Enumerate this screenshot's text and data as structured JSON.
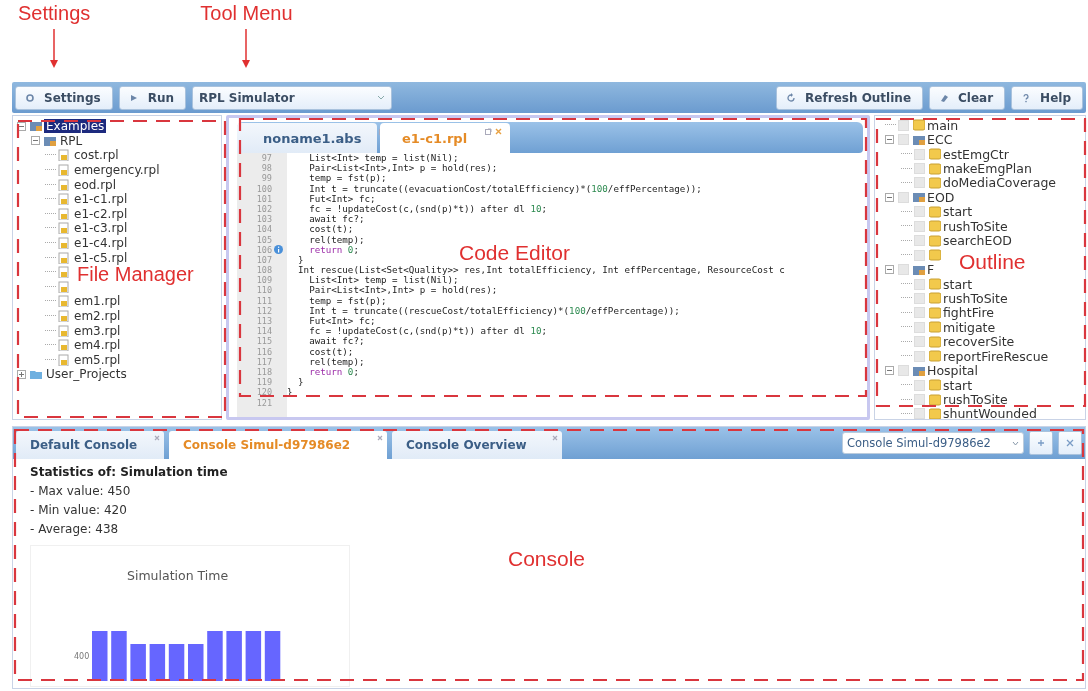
{
  "annotations": {
    "settings_callout": "Settings",
    "tool_menu_callout": "Tool Menu",
    "file_manager_label": "File Manager",
    "code_editor_label": "Code Editor",
    "outline_label": "Outline",
    "console_label": "Console"
  },
  "toolbar": {
    "left_buttons": [
      {
        "label": "Settings"
      },
      {
        "label": "Run"
      }
    ],
    "tool_select": "RPL Simulator",
    "right_buttons": [
      {
        "label": "Refresh Outline"
      },
      {
        "label": "Clear"
      },
      {
        "label": "Help"
      }
    ]
  },
  "file_tree": [
    {
      "label": "Examples",
      "kind": "package",
      "selected": true,
      "expanded": true,
      "children": [
        {
          "label": "RPL",
          "kind": "package",
          "selected": false,
          "expanded": true,
          "children": [
            {
              "label": "cost.rpl",
              "kind": "file",
              "selected": false
            },
            {
              "label": "emergency.rpl",
              "kind": "file",
              "selected": false
            },
            {
              "label": "eod.rpl",
              "kind": "file",
              "selected": false
            },
            {
              "label": "e1-c1.rpl",
              "kind": "file",
              "selected": false
            },
            {
              "label": "e1-c2.rpl",
              "kind": "file",
              "selected": false
            },
            {
              "label": "e1-c3.rpl",
              "kind": "file",
              "selected": false
            },
            {
              "label": "e1-c4.rpl",
              "kind": "file",
              "selected": false
            },
            {
              "label": "e1-c5.rpl",
              "kind": "file",
              "selected": false
            },
            {
              "kind": "file"
            },
            {
              "kind": "file"
            },
            {
              "label": "em1.rpl",
              "kind": "file",
              "selected": false
            },
            {
              "label": "em2.rpl",
              "kind": "file",
              "selected": false
            },
            {
              "label": "em3.rpl",
              "kind": "file",
              "selected": false
            },
            {
              "label": "em4.rpl",
              "kind": "file",
              "selected": false
            },
            {
              "label": "em5.rpl",
              "kind": "file",
              "selected": false
            }
          ]
        }
      ]
    },
    {
      "label": "User_Projects",
      "kind": "folder",
      "selected": false,
      "expanded": false
    }
  ],
  "editor": {
    "tabs": [
      {
        "label": "noname1.abs",
        "selected": false
      },
      {
        "label": "e1-c1.rpl",
        "selected": true
      }
    ],
    "lines": [
      {
        "number": "97",
        "parts": [
          {
            "text": "    List<Int> temp = list(Nil);",
            "kind": "code"
          }
        ]
      },
      {
        "number": "98",
        "parts": [
          {
            "text": "    Pair<List<Int>,Int> p = hold(res);",
            "kind": "code"
          }
        ]
      },
      {
        "number": "99",
        "parts": [
          {
            "text": "    temp = fst(p);",
            "kind": "code"
          }
        ]
      },
      {
        "number": "100",
        "parts": [
          {
            "text": "    Int t = truncate((evacuationCost/totalEfficiency)*(",
            "kind": "code"
          },
          {
            "text": "100",
            "kind": "number"
          },
          {
            "text": "/effPercentage));",
            "kind": "code"
          }
        ]
      },
      {
        "number": "101",
        "parts": [
          {
            "text": "    Fut<Int> fc;",
            "kind": "code"
          }
        ]
      },
      {
        "number": "102",
        "parts": [
          {
            "text": "    fc = !updateCost(c,(snd(p)*t)) after dl ",
            "kind": "code"
          },
          {
            "text": "10",
            "kind": "number"
          },
          {
            "text": ";",
            "kind": "code"
          }
        ]
      },
      {
        "number": "103",
        "parts": [
          {
            "text": "    await fc?;",
            "kind": "code"
          }
        ]
      },
      {
        "number": "104",
        "parts": [
          {
            "text": "    cost(t);",
            "kind": "code"
          }
        ]
      },
      {
        "number": "105",
        "parts": [
          {
            "text": "    rel(temp);",
            "kind": "code"
          }
        ]
      },
      {
        "number": "106",
        "info_marker": true,
        "parts": [
          {
            "text": "    return",
            "kind": "keyword"
          },
          {
            "text": " 0",
            "kind": "number"
          },
          {
            "text": ";",
            "kind": "code"
          }
        ]
      },
      {
        "number": "107",
        "parts": [
          {
            "text": "  }",
            "kind": "code"
          }
        ]
      },
      {
        "number": "108",
        "parts": [
          {
            "text": "  Int rescue(List<Set<Quality>> res,Int totalEfficiency, Int effPercentage, ResourceCost c",
            "kind": "code"
          }
        ]
      },
      {
        "number": "109",
        "parts": [
          {
            "text": "    List<Int> temp = list(Nil);",
            "kind": "code"
          }
        ]
      },
      {
        "number": "110",
        "parts": [
          {
            "text": "    Pair<List<Int>,Int> p = hold(res);",
            "kind": "code"
          }
        ]
      },
      {
        "number": "111",
        "parts": [
          {
            "text": "    temp = fst(p);",
            "kind": "code"
          }
        ]
      },
      {
        "number": "112",
        "parts": [
          {
            "text": "    Int t = truncate((rescueCost/totalEfficiency)*(",
            "kind": "code"
          },
          {
            "text": "100",
            "kind": "number"
          },
          {
            "text": "/effPercentage));",
            "kind": "code"
          }
        ]
      },
      {
        "number": "113",
        "parts": [
          {
            "text": "    Fut<Int> fc;",
            "kind": "code"
          }
        ]
      },
      {
        "number": "114",
        "parts": [
          {
            "text": "    fc = !updateCost(c,(snd(p)*t)) after dl ",
            "kind": "code"
          },
          {
            "text": "10",
            "kind": "number"
          },
          {
            "text": ";",
            "kind": "code"
          }
        ]
      },
      {
        "number": "115",
        "parts": [
          {
            "text": "    await fc?;",
            "kind": "code"
          }
        ]
      },
      {
        "number": "116",
        "parts": [
          {
            "text": "    cost(t);",
            "kind": "code"
          }
        ]
      },
      {
        "number": "117",
        "parts": [
          {
            "text": "    rel(temp);",
            "kind": "code"
          }
        ]
      },
      {
        "number": "118",
        "parts": [
          {
            "text": "    return",
            "kind": "keyword"
          },
          {
            "text": " 0",
            "kind": "number"
          },
          {
            "text": ";",
            "kind": "code"
          }
        ]
      },
      {
        "number": "119",
        "parts": [
          {
            "text": "  }",
            "kind": "code"
          }
        ]
      },
      {
        "number": "120",
        "parts": [
          {
            "text": "}",
            "kind": "code"
          }
        ]
      },
      {
        "number": "121"
      }
    ]
  },
  "outline": [
    {
      "label": "main",
      "kind": "method",
      "checked": false
    },
    {
      "label": "ECC",
      "kind": "class",
      "checked": false,
      "expanded": true,
      "children": [
        {
          "label": "estEmgCtr",
          "kind": "method",
          "checked": false
        },
        {
          "label": "makeEmgPlan",
          "kind": "method",
          "checked": false
        },
        {
          "label": "doMediaCoverage",
          "kind": "method",
          "checked": false
        }
      ]
    },
    {
      "label": "EOD",
      "kind": "class",
      "checked": false,
      "expanded": true,
      "children": [
        {
          "label": "start",
          "kind": "method",
          "checked": false
        },
        {
          "label": "rushToSite",
          "kind": "method",
          "checked": false
        },
        {
          "label": "searchEOD",
          "kind": "method",
          "checked": false
        },
        {
          "kind": "method",
          "checked": false
        }
      ]
    },
    {
      "label": "F",
      "kind": "class",
      "checked": false,
      "expanded": true,
      "children": [
        {
          "label": "start",
          "kind": "method",
          "checked": false
        },
        {
          "label": "rushToSite",
          "kind": "method",
          "checked": false
        },
        {
          "label": "fightFire",
          "kind": "method",
          "checked": false
        },
        {
          "label": "mitigate",
          "kind": "method",
          "checked": false
        },
        {
          "label": "recoverSite",
          "kind": "method",
          "checked": false
        },
        {
          "label": "reportFireRescue",
          "kind": "method",
          "checked": false
        }
      ]
    },
    {
      "label": "Hospital",
      "kind": "class",
      "checked": false,
      "expanded": true,
      "children": [
        {
          "label": "start",
          "kind": "method",
          "checked": false
        },
        {
          "label": "rushToSite",
          "kind": "method",
          "checked": false
        },
        {
          "label": "shuntWounded",
          "kind": "method",
          "checked": false
        }
      ]
    }
  ],
  "console": {
    "tabs": [
      {
        "label": "Default Console",
        "selected": false
      },
      {
        "label": "Console Simul-d97986e2",
        "selected": true
      },
      {
        "label": "Console Overview",
        "selected": false
      }
    ],
    "selector": "Console Simul-d97986e2",
    "heading": "Statistics of: Simulation time",
    "stats": [
      "- Max value: 450",
      "- Min value: 420",
      "- Average: 438"
    ],
    "chart": {
      "title": "Simulation Time",
      "axis_label": "400"
    }
  }
}
